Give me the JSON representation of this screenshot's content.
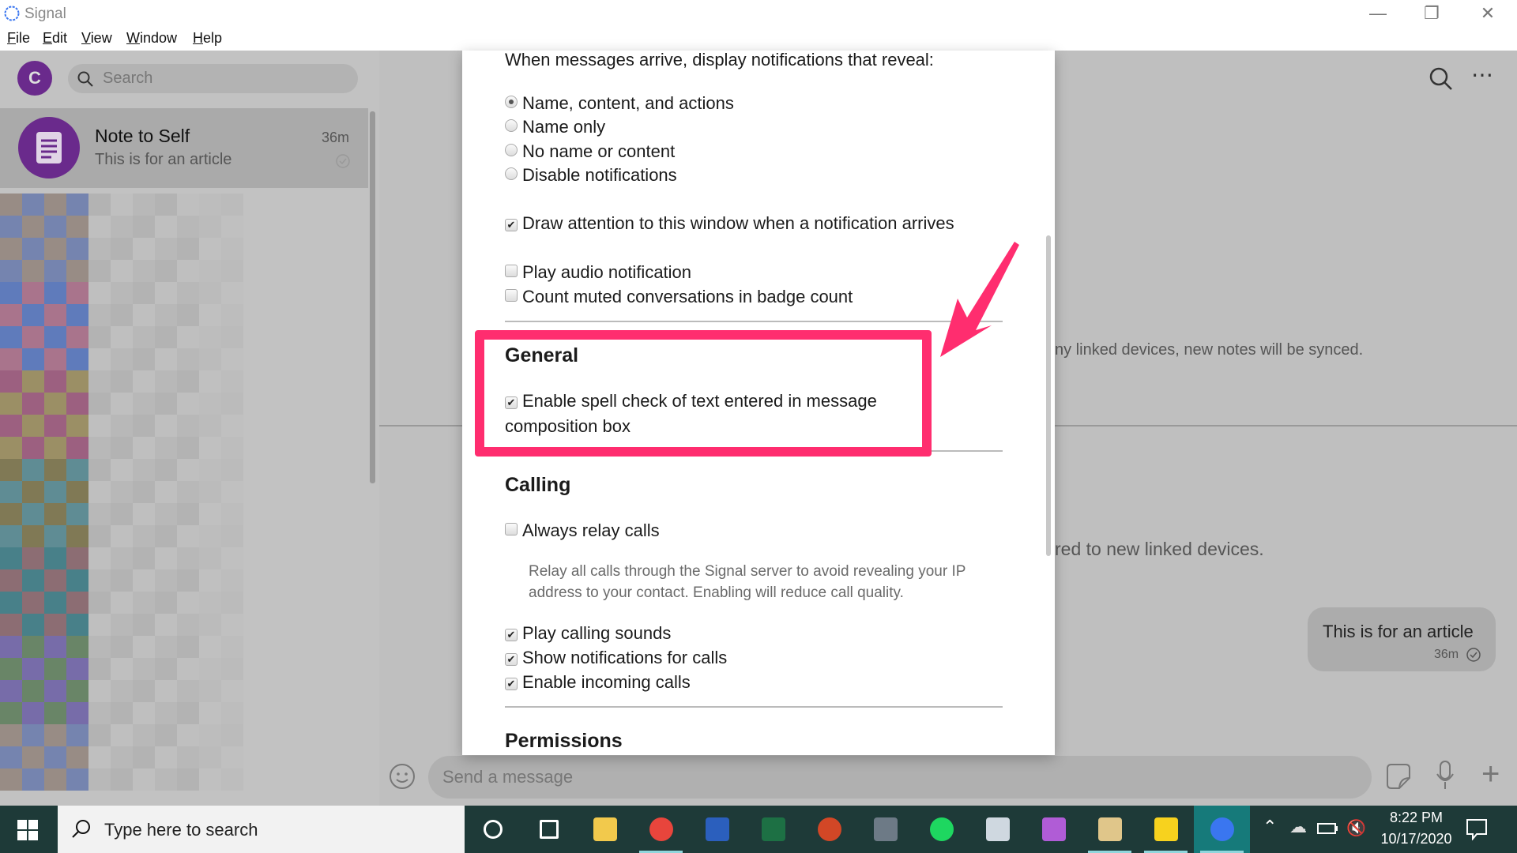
{
  "window": {
    "title": "Signal",
    "menu": [
      "File",
      "Edit",
      "View",
      "Window",
      "Help"
    ]
  },
  "sidebar": {
    "avatar_initial": "C",
    "search_placeholder": "Search",
    "conversations": [
      {
        "name": "Note to Self",
        "preview": "This is for an article",
        "time": "36m"
      }
    ]
  },
  "main": {
    "info_1": "ny linked devices, new notes will be synced.",
    "info_2": "red to new linked devices.",
    "bubble": {
      "text": "This is for an article",
      "time": "36m"
    },
    "composer_placeholder": "Send a message"
  },
  "settings": {
    "notify_heading": "When messages arrive, display notifications that reveal:",
    "notify_options": [
      {
        "label": "Name, content, and actions",
        "selected": true
      },
      {
        "label": "Name only",
        "selected": false
      },
      {
        "label": "No name or content",
        "selected": false
      },
      {
        "label": "Disable notifications",
        "selected": false
      }
    ],
    "draw_attention": {
      "label": "Draw attention to this window when a notification arrives",
      "checked": true
    },
    "audio": {
      "label": "Play audio notification",
      "checked": false
    },
    "count_muted": {
      "label": "Count muted conversations in badge count",
      "checked": false
    },
    "general_heading": "General",
    "spell_check": {
      "label_1": "Enable spell check of text entered in message",
      "label_2": "composition box",
      "checked": true
    },
    "calling_heading": "Calling",
    "relay": {
      "label": "Always relay calls",
      "checked": false,
      "desc_1": "Relay all calls through the Signal server to avoid revealing your IP",
      "desc_2": "address to your contact. Enabling will reduce call quality."
    },
    "calling_sounds": {
      "label": "Play calling sounds",
      "checked": true
    },
    "call_notifications": {
      "label": "Show notifications for calls",
      "checked": true
    },
    "incoming_calls": {
      "label": "Enable incoming calls",
      "checked": true
    },
    "permissions_heading": "Permissions"
  },
  "annotation_color": "#ff2d6f",
  "taskbar": {
    "search_placeholder": "Type here to search",
    "time": "8:22 PM",
    "date": "10/17/2020"
  }
}
